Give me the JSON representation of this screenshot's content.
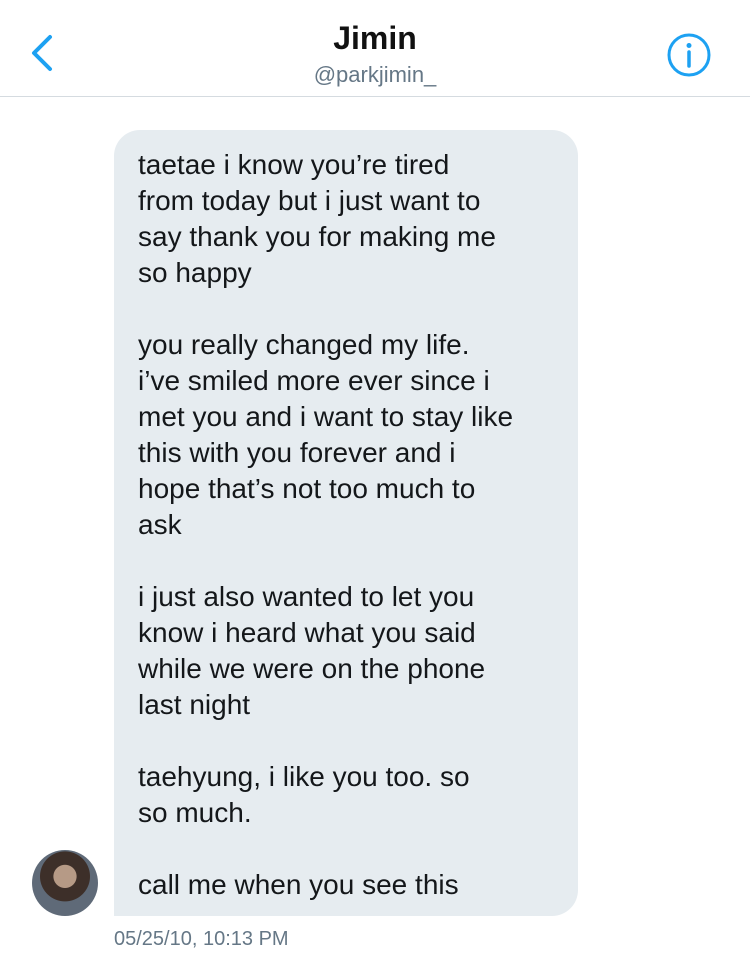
{
  "header": {
    "title": "Jimin",
    "subtitle": "@parkjimin_"
  },
  "icons": {
    "back": "chevron-left-icon",
    "info": "info-circle-icon"
  },
  "colors": {
    "accent": "#1da1f2",
    "bubble": "#e6ecf0",
    "secondary_text": "#657786"
  },
  "message": {
    "paragraphs": [
      "taetae i know you’re tired\nfrom today but i just want to\nsay thank you for making me\nso happy",
      "you really changed my life.\ni’ve smiled more ever since i\nmet you and i want to stay like\nthis with you forever and i\nhope that’s not too much to\nask",
      "i just also wanted to let you\nknow i heard what you said\nwhile we were on the phone\nlast night",
      "taehyung, i like you too. so\nso much.",
      "call me when you see this"
    ],
    "timestamp": "05/25/10, 10:13 PM"
  }
}
